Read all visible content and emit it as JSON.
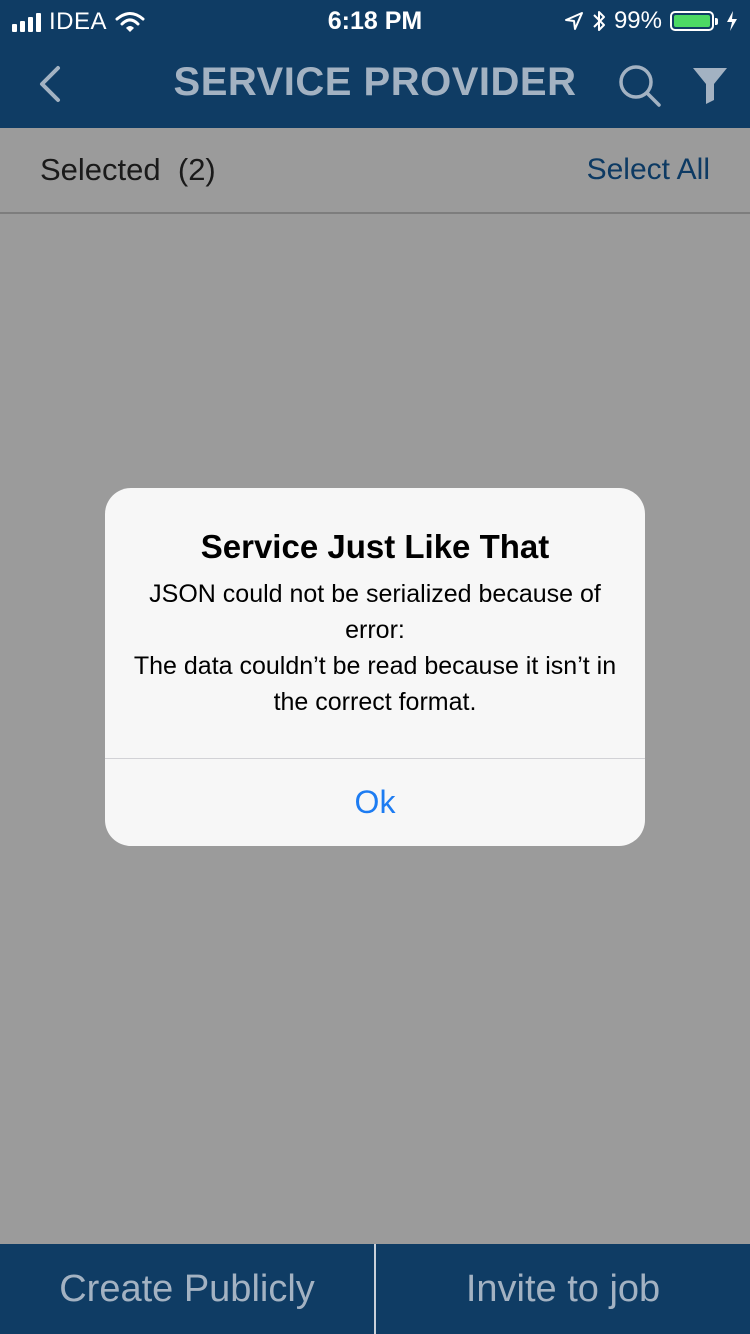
{
  "status_bar": {
    "carrier": "IDEA",
    "time": "6:18 PM",
    "battery": "99%",
    "battery_level": 0.99,
    "icons": [
      "signal-icon",
      "wifi-icon",
      "location-icon",
      "bluetooth-icon",
      "battery-icon",
      "charging-icon"
    ]
  },
  "nav": {
    "title": "SERVICE PROVIDER",
    "icons": [
      "back-icon",
      "search-icon",
      "filter-icon"
    ]
  },
  "selection": {
    "label": "Selected  (2)",
    "select_all": "Select All"
  },
  "alert": {
    "title": "Service Just Like That",
    "message": "JSON could not be serialized because of error:\nThe data couldn’t be read because it isn’t in the correct format.",
    "ok": "Ok"
  },
  "bottom": {
    "create_publicly": "Create Publicly",
    "invite_to_job": "Invite to job"
  },
  "colors": {
    "nav_bg": "#0f3c64",
    "overlay": "#9b9b9b",
    "alert_bg": "#f7f7f7",
    "link_blue": "#1d7cf2",
    "select_all": "#0d3a63",
    "battery_green": "#4cd964"
  }
}
